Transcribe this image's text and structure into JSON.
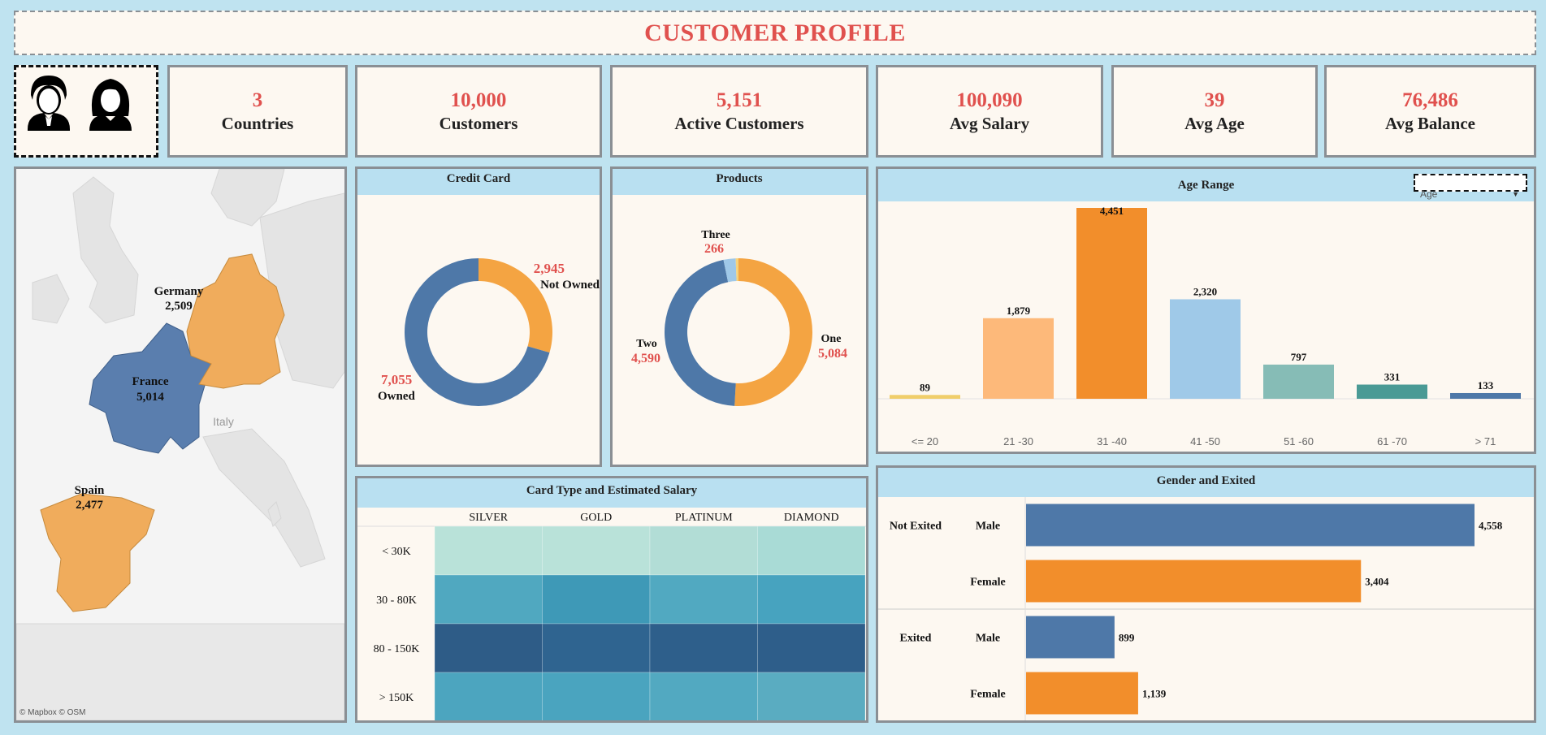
{
  "title": "CUSTOMER PROFILE",
  "kpis": [
    {
      "value": "3",
      "label": "Countries"
    },
    {
      "value": "10,000",
      "label": "Customers"
    },
    {
      "value": "5,151",
      "label": "Active Customers"
    },
    {
      "value": "100,090",
      "label": "Avg Salary"
    },
    {
      "value": "39",
      "label": "Avg Age"
    },
    {
      "value": "76,486",
      "label": "Avg Balance"
    }
  ],
  "map": {
    "countries": [
      {
        "name": "France",
        "value": "5,014"
      },
      {
        "name": "Germany",
        "value": "2,509"
      },
      {
        "name": "Spain",
        "value": "2,477"
      }
    ],
    "other_label": "Italy",
    "attribution": "© Mapbox © OSM",
    "colors": {
      "france": "#5a7eae",
      "germany": "#f0ac5c",
      "spain": "#f0ac5c",
      "land": "#e2e2e2",
      "sea": "#f4f4f4"
    }
  },
  "credit_card": {
    "title": "Credit Card",
    "slices": [
      {
        "label": "Not Owned",
        "value": "2,945",
        "count": 2945,
        "color": "#f4a442"
      },
      {
        "label": "Owned",
        "value": "7,055",
        "count": 7055,
        "color": "#4e78a8"
      }
    ]
  },
  "products": {
    "title": "Products",
    "slices": [
      {
        "label": "One",
        "value": "5,084",
        "count": 5084,
        "color": "#f4a442"
      },
      {
        "label": "Two",
        "value": "4,590",
        "count": 4590,
        "color": "#4e78a8"
      },
      {
        "label": "Three",
        "value": "266",
        "count": 266,
        "color": "#9fc8e8"
      },
      {
        "label": "",
        "value": "",
        "count": 60,
        "color": "#f7d27a"
      }
    ]
  },
  "age_range": {
    "title": "Age Range",
    "dropdown_value": "Age",
    "categories": [
      "<= 20",
      "21 -30",
      "31 -40",
      "41 -50",
      "51 -60",
      "61 -70",
      "> 71"
    ],
    "values": [
      89,
      1879,
      4451,
      2320,
      797,
      331,
      133
    ],
    "labels": [
      "89",
      "1,879",
      "4,451",
      "2,320",
      "797",
      "331",
      "133"
    ],
    "colors": [
      "#f0ce6a",
      "#fdb97a",
      "#f28e2b",
      "#9fc9e8",
      "#86bcb6",
      "#4a9a95",
      "#4e78a8"
    ],
    "ylim": [
      0,
      4451
    ]
  },
  "card_salary": {
    "title": "Card Type and Estimated Salary",
    "columns": [
      "SILVER",
      "GOLD",
      "PLATINUM",
      "DIAMOND"
    ],
    "rows": [
      "< 30K",
      "30 - 80K",
      "80 - 150K",
      "> 150K"
    ],
    "colors": [
      [
        "#b9e2d9",
        "#b9e2d9",
        "#b2ddd6",
        "#a9dbd6"
      ],
      [
        "#50a8c0",
        "#3e99b7",
        "#51a9c1",
        "#47a3bf"
      ],
      [
        "#2e5c87",
        "#2f6490",
        "#2e5f8b",
        "#2e5e8a"
      ],
      [
        "#4ca5bf",
        "#4aa4bf",
        "#52a9c1",
        "#5aacc1"
      ]
    ]
  },
  "gender_exited": {
    "title": "Gender and Exited",
    "groups": [
      {
        "name": "Not Exited",
        "rows": [
          {
            "gender": "Male",
            "value": 4558,
            "label": "4,558",
            "color": "#4e78a8"
          },
          {
            "gender": "Female",
            "value": 3404,
            "label": "3,404",
            "color": "#f28e2b"
          }
        ]
      },
      {
        "name": "Exited",
        "rows": [
          {
            "gender": "Male",
            "value": 899,
            "label": "899",
            "color": "#4e78a8"
          },
          {
            "gender": "Female",
            "value": 1139,
            "label": "1,139",
            "color": "#f28e2b"
          }
        ]
      }
    ]
  },
  "chart_data": [
    {
      "type": "pie",
      "title": "Credit Card",
      "categories": [
        "Not Owned",
        "Owned"
      ],
      "values": [
        2945,
        7055
      ]
    },
    {
      "type": "pie",
      "title": "Products",
      "categories": [
        "One",
        "Two",
        "Three"
      ],
      "values": [
        5084,
        4590,
        266
      ]
    },
    {
      "type": "bar",
      "title": "Age Range",
      "categories": [
        "<= 20",
        "21 -30",
        "31 -40",
        "41 -50",
        "51 -60",
        "61 -70",
        "> 71"
      ],
      "values": [
        89,
        1879,
        4451,
        2320,
        797,
        331,
        133
      ]
    },
    {
      "type": "bar",
      "title": "Gender and Exited",
      "categories": [
        "Not Exited Male",
        "Not Exited Female",
        "Exited Male",
        "Exited Female"
      ],
      "values": [
        4558,
        3404,
        899,
        1139
      ]
    }
  ]
}
